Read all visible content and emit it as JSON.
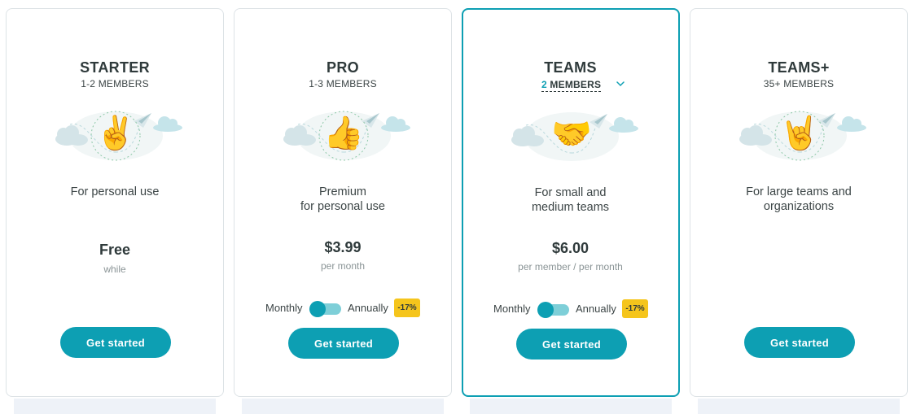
{
  "plans": [
    {
      "name": "STARTER",
      "members": "1-2 MEMBERS",
      "emoji": "✌️",
      "emoji_name": "victory-hand-icon",
      "description": [
        "For personal use"
      ],
      "price": "Free",
      "price_sub": "while",
      "cta": "Get started"
    },
    {
      "name": "PRO",
      "members": "1-3 MEMBERS",
      "emoji": "👍",
      "emoji_name": "thumbs-up-icon",
      "description": [
        "Premium",
        "for personal use"
      ],
      "price": "$3.99",
      "price_sub": "per month",
      "billing": {
        "monthly": "Monthly",
        "annually": "Annually",
        "discount": "-17%",
        "selected": "Monthly"
      },
      "cta": "Get started"
    },
    {
      "name": "TEAMS",
      "members_count": "2",
      "members_label": "MEMBERS",
      "emoji": "🤝",
      "emoji_name": "handshake-icon",
      "description": [
        "For small and",
        "medium teams"
      ],
      "price": "$6.00",
      "price_sub": "per member / per month",
      "billing": {
        "monthly": "Monthly",
        "annually": "Annually",
        "discount": "-17%",
        "selected": "Monthly"
      },
      "cta": "Get started",
      "featured": true
    },
    {
      "name": "TEAMS+",
      "members": "35+ MEMBERS",
      "emoji": "🤘",
      "emoji_name": "rock-on-hand-icon",
      "description": [
        "For large teams and",
        "organizations"
      ],
      "cta": "Get started"
    }
  ],
  "colors": {
    "accent": "#0d9fb3",
    "toggle_track": "#7ecfd8",
    "badge": "#f5c51c",
    "text": "#2f3a3b"
  }
}
